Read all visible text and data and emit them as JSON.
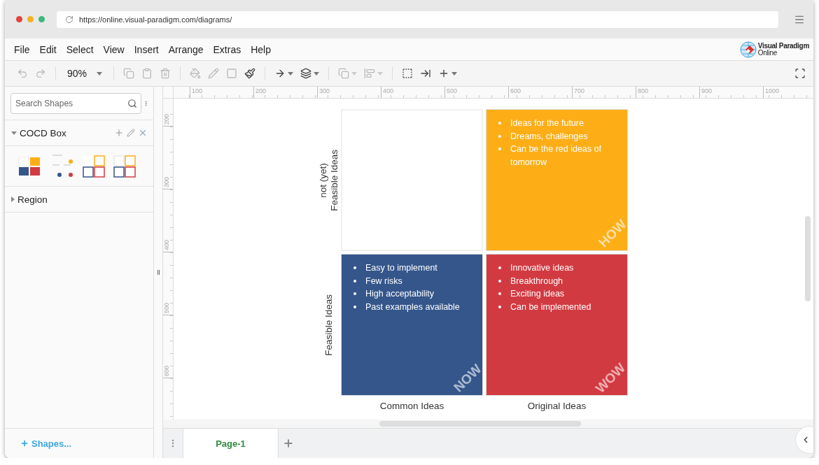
{
  "browser": {
    "url": "https://online.visual-paradigm.com/diagrams/"
  },
  "menu": [
    "File",
    "Edit",
    "Select",
    "View",
    "Insert",
    "Arrange",
    "Extras",
    "Help"
  ],
  "logo": {
    "line_1": "Visual Paradigm",
    "line_2": "Online"
  },
  "toolbar": {
    "zoom": "90%"
  },
  "sidebar": {
    "search": {
      "placeholder": "Search Shapes"
    },
    "sections": [
      {
        "title": "COCD Box",
        "expanded": true
      },
      {
        "title": "Region",
        "expanded": false
      }
    ],
    "more_shapes": "Shapes..."
  },
  "rulers": {
    "horizontal": [
      "100",
      "200",
      "300",
      "400",
      "500",
      "600",
      "700",
      "800",
      "900",
      "1000"
    ],
    "vertical": [
      "200",
      "300",
      "400",
      "500",
      "600"
    ]
  },
  "diagram": {
    "row_labels": [
      [
        "not (yet)",
        "Feasible Ideas"
      ],
      [
        "Feasible Ideas"
      ]
    ],
    "column_labels": [
      "Common Ideas",
      "Original Ideas"
    ],
    "quadrants": [
      {
        "kind": "empty"
      },
      {
        "kind": "filled",
        "color": "#fdae17",
        "corner_label": "HOW",
        "items": [
          "Ideas for the future",
          "Dreams, challenges",
          "Can be the red ideas of tomorrow"
        ]
      },
      {
        "kind": "filled",
        "color": "#34568b",
        "corner_label": "NOW",
        "items": [
          "Easy to implement",
          "Few risks",
          "High acceptability",
          "Past examples available"
        ]
      },
      {
        "kind": "filled",
        "color": "#d23a41",
        "corner_label": "WOW",
        "items": [
          "Innovative ideas",
          "Breakthrough",
          "Exciting ideas",
          "Can be implemented"
        ]
      }
    ]
  },
  "pages": [
    {
      "label": "Page-1",
      "selected": true
    }
  ]
}
